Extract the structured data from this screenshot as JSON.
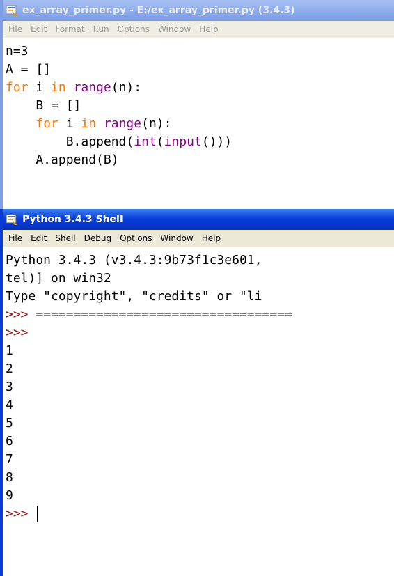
{
  "editor": {
    "title": "ex_array_primer.py - E:/ex_array_primer.py (3.4.3)",
    "menu": [
      "File",
      "Edit",
      "Format",
      "Run",
      "Options",
      "Window",
      "Help"
    ],
    "code": {
      "line1": "n=3",
      "line2": "A = []",
      "line3": {
        "kw_for": "for",
        "var": " i ",
        "kw_in": "in",
        "sp": " ",
        "fn": "range",
        "args": "(n):"
      },
      "line4": "    B = []",
      "line5": {
        "indent": "    ",
        "kw_for": "for",
        "var": " i ",
        "kw_in": "in",
        "sp": " ",
        "fn": "range",
        "args": "(n):"
      },
      "line6": {
        "pre": "        B.append(",
        "fn_int": "int",
        "open": "(",
        "fn_input": "input",
        "close": "()))"
      },
      "line7": "    A.append(B)"
    }
  },
  "shell": {
    "title": "Python 3.4.3 Shell",
    "menu": [
      "File",
      "Edit",
      "Shell",
      "Debug",
      "Options",
      "Window",
      "Help"
    ],
    "banner": [
      "Python 3.4.3 (v3.4.3:9b73f1c3e601,",
      "tel)] on win32",
      "Type \"copyright\", \"credits\" or \"li"
    ],
    "prompt": ">>>",
    "restart_line": " ==================================",
    "outputs": [
      "1",
      "2",
      "3",
      "4",
      "5",
      "6",
      "7",
      "8",
      "9"
    ],
    "final_prompt": ">>> "
  }
}
